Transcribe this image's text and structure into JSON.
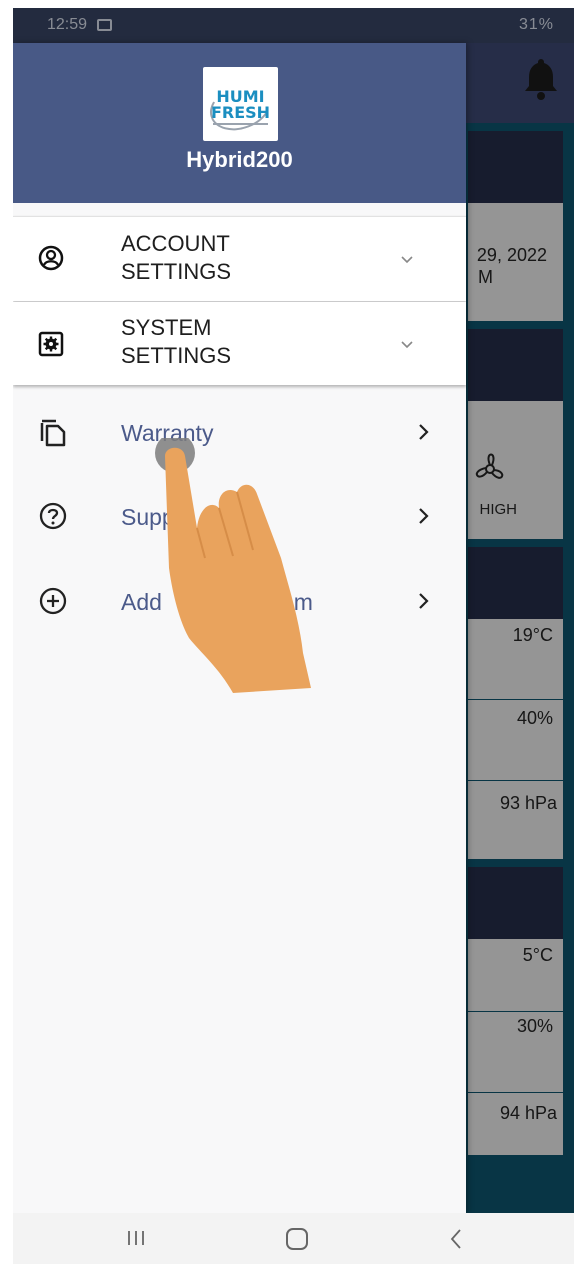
{
  "status_bar": {
    "time": "12:59",
    "battery": "31%"
  },
  "background": {
    "date_text": "29, 2022",
    "date_text_2": "M",
    "fan_label": "HIGH",
    "values": [
      "19°C",
      "40%",
      "93 hPa",
      "5°C",
      "30%",
      "94 hPa"
    ]
  },
  "drawer": {
    "logo_line1": "HUMI",
    "logo_line2": "FRESH",
    "app_name": "Hybrid200",
    "sections": [
      {
        "label_line1": "ACCOUNT",
        "label_line2": "SETTINGS",
        "icon": "account-circle-icon"
      },
      {
        "label_line1": "SYSTEM",
        "label_line2": "SETTINGS",
        "icon": "settings-box-icon"
      }
    ],
    "items": [
      {
        "label": "Warranty",
        "icon": "copy-document-icon"
      },
      {
        "label": "Supp",
        "icon": "help-circle-icon"
      },
      {
        "label": "Add",
        "label_tail": "em",
        "icon": "add-circle-icon"
      }
    ]
  },
  "colors": {
    "drawer_header": "#485986",
    "accent_text": "#4b5a8a",
    "hand": "#e9a35d"
  }
}
